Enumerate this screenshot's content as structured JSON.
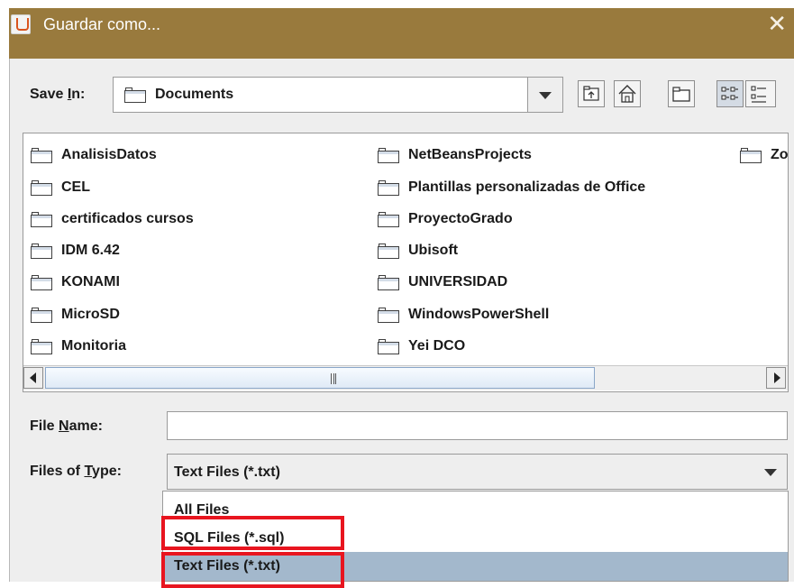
{
  "window": {
    "title": "Guardar como...",
    "close_glyph": "✕",
    "app_icon": "java-cup-icon"
  },
  "save_in": {
    "label_pre": "Save ",
    "label_mnemonic": "I",
    "label_post": "n:",
    "value": "Documents",
    "folder_icon": "folder-icon"
  },
  "toolbar": {
    "buttons": [
      "up-one-level-icon",
      "home-icon",
      "new-folder-icon",
      "list-view-icon",
      "details-view-icon"
    ],
    "selected": "list-view-icon"
  },
  "files": {
    "column1": [
      "AnalisisDatos",
      "CEL",
      "certificados cursos",
      "IDM 6.42",
      "KONAMI",
      "MicroSD",
      "Monitoria"
    ],
    "column2": [
      "NetBeansProjects",
      "Plantillas personalizadas de Office",
      "ProyectoGrado",
      "Ubisoft",
      "UNIVERSIDAD",
      "WindowsPowerShell",
      "Yei DCO"
    ],
    "column3": [
      "Zoo"
    ]
  },
  "file_name": {
    "label_pre": "File ",
    "label_mnemonic": "N",
    "label_post": "ame:",
    "value": ""
  },
  "files_of_type": {
    "label_pre": "Files of ",
    "label_mnemonic": "T",
    "label_post": "ype:",
    "value": "Text Files (*.txt)",
    "options": [
      "All Files",
      "SQL Files (*.sql)",
      "Text Files (*.txt)"
    ],
    "highlighted": "Text Files (*.txt)"
  },
  "annotations": {
    "highlight_color": "#e8151f"
  },
  "colors": {
    "titlebar": "#997a3d",
    "selection": "#a3b8cc"
  }
}
